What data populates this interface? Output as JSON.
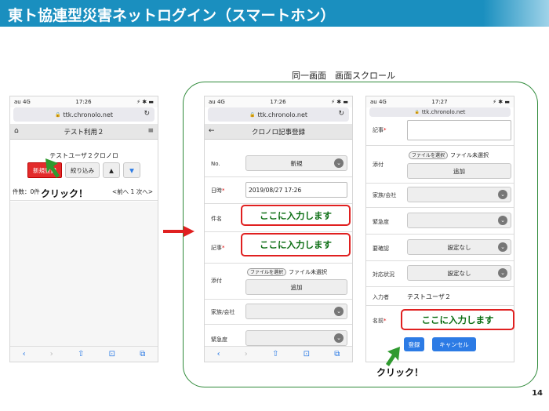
{
  "slide": {
    "title": "東ト協連型災害ネットログイン（スマートホン）",
    "scroll_caption": "同一画面　画面スクロール",
    "page_number": "14"
  },
  "colors": {
    "accent": "#1a8fbf",
    "callout_red": "#e02020",
    "callout_green_text": "#0a6d12",
    "frame_green": "#2f8a3a"
  },
  "status": {
    "carrier": "au",
    "network": "4G",
    "time1": "17:26",
    "time2": "17:26",
    "time3": "17:27",
    "right": "⚡ ✱ ▬"
  },
  "url": "ttk.chronolo.net",
  "phone1": {
    "appbar_title": "テスト利用２",
    "user": "テストユーザ２クロノロ",
    "btn_new": "新規登録",
    "btn_filter": "絞り込み",
    "btn_up": "▲",
    "btn_down": "▼",
    "count": "件数：0件",
    "pager": "<前へ 1 次へ>",
    "click": "クリック！"
  },
  "phone2": {
    "appbar_title": "クロノロ記事登録",
    "no_label": "No.",
    "no_value": "新規",
    "datetime_label": "日時",
    "datetime_value": "2019/08/27 17:26",
    "subject_label": "件名",
    "article_label": "記事",
    "attach_label": "添付",
    "file_btn": "ファイルを選択",
    "file_none": "ファイル未選択",
    "add_btn": "追加",
    "family_label": "家族/会社",
    "urgency_label": "緊急度",
    "callout": "ここに入力します"
  },
  "phone3": {
    "article_label": "記事",
    "attach_label": "添付",
    "file_btn": "ファイルを選択",
    "file_none": "ファイル未選択",
    "add_btn": "追加",
    "family_label": "家族/会社",
    "urgency_label": "緊急度",
    "confirm_label": "要確認",
    "confirm_value": "設定なし",
    "status_label": "対応状況",
    "status_value": "設定なし",
    "inputter_label": "入力者",
    "inputter_value": "テストユーザ２",
    "name_label": "名前",
    "callout": "ここに入力します",
    "register_btn": "登録",
    "cancel_btn": "キャンセル",
    "click": "クリック！"
  },
  "icons": {
    "back": "‹",
    "forward": "›",
    "share": "⇧",
    "book": "📖",
    "tabs": "⧉",
    "home": "⌂",
    "menu": "≡",
    "reload": "↻",
    "left_arrow": "←"
  }
}
